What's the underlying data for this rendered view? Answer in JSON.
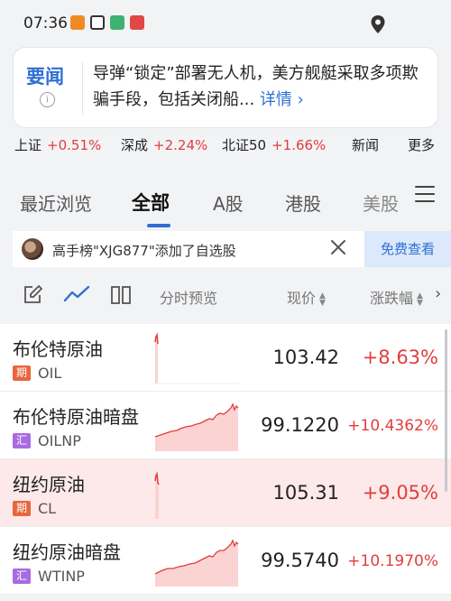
{
  "status": {
    "time": "07:36"
  },
  "news": {
    "tag": "要闻",
    "text": "导弹“锁定”部署无人机，美方舰艇采取多项欺骗手段，包括关闭船...",
    "more": "详情 ›"
  },
  "ticker": [
    {
      "name": "上证",
      "value": "+0.51%"
    },
    {
      "name": "深成",
      "value": "+2.24%"
    },
    {
      "name": "北证50",
      "value": "+1.66%"
    }
  ],
  "ticker_links": {
    "news": "新闻",
    "more": "更多"
  },
  "tabs": [
    {
      "label": "最近浏览"
    },
    {
      "label": "全部"
    },
    {
      "label": "A股"
    },
    {
      "label": "港股"
    },
    {
      "label": "美股"
    }
  ],
  "follow": {
    "text": "高手榜\"XJG877\"添加了自选股",
    "button": "免费查看"
  },
  "header": {
    "preview": "分时预览",
    "price": "现价",
    "change": "涨跌幅"
  },
  "rows": [
    {
      "name": "布伦特原油",
      "badge": "期",
      "code": "OIL",
      "price": "103.42",
      "change": "+8.63%"
    },
    {
      "name": "布伦特原油暗盘",
      "badge": "汇",
      "code": "OILNP",
      "price": "99.1220",
      "change": "+10.4362%"
    },
    {
      "name": "纽约原油",
      "badge": "期",
      "code": "CL",
      "price": "105.31",
      "change": "+9.05%"
    },
    {
      "name": "纽约原油暗盘",
      "badge": "汇",
      "code": "WTINP",
      "price": "99.5740",
      "change": "+10.1970%"
    }
  ],
  "colors": {
    "accent": "#2f6fd6",
    "up": "#e23d3d",
    "badge_futures": "#e8663d",
    "badge_fx": "#a86be0"
  }
}
